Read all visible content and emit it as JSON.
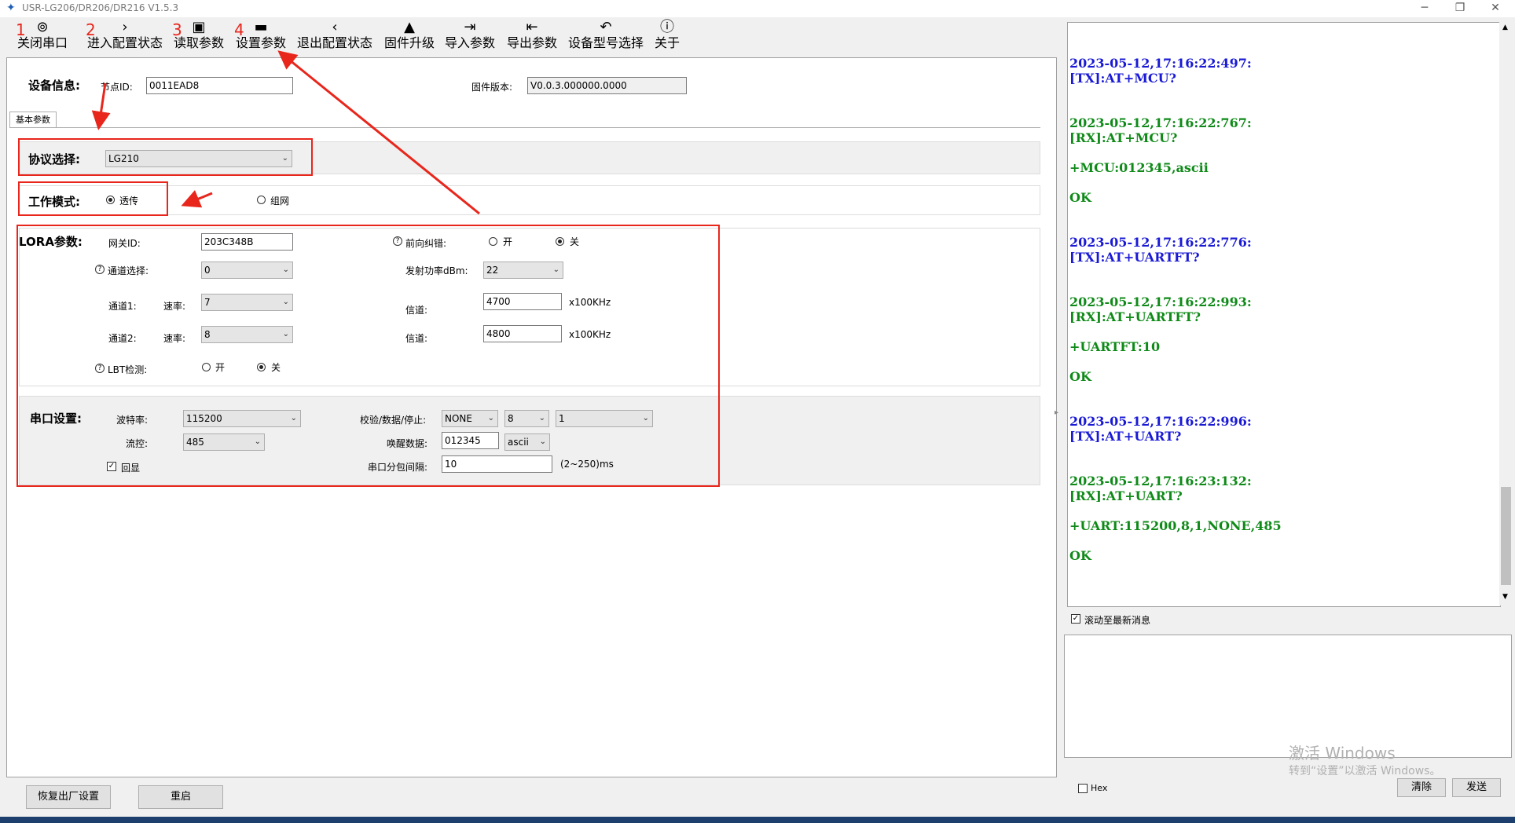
{
  "window": {
    "title": "USR-LG206/DR206/DR216 V1.5.3"
  },
  "toolbar": {
    "items": [
      {
        "num": "1",
        "label": "关闭串口",
        "icon": "location-pin-icon"
      },
      {
        "num": "2",
        "label": "进入配置状态",
        "icon": "chevron-right-icon"
      },
      {
        "num": "3",
        "label": "读取参数",
        "icon": "read-params-icon"
      },
      {
        "num": "4",
        "label": "设置参数",
        "icon": "save-icon"
      },
      {
        "num": "",
        "label": "退出配置状态",
        "icon": "chevron-left-icon"
      },
      {
        "num": "",
        "label": "固件升级",
        "icon": "rocket-icon"
      },
      {
        "num": "",
        "label": "导入参数",
        "icon": "import-icon"
      },
      {
        "num": "",
        "label": "导出参数",
        "icon": "export-icon"
      },
      {
        "num": "",
        "label": "设备型号选择",
        "icon": "undo-icon"
      },
      {
        "num": "",
        "label": "关于",
        "icon": "info-icon"
      }
    ]
  },
  "device": {
    "heading": "设备信息:",
    "node_id_label": "节点ID:",
    "node_id": "0011EAD8",
    "firmware_label": "固件版本:",
    "firmware": "V0.0.3.000000.0000",
    "tab": "基本参数"
  },
  "protocol": {
    "label": "协议选择:",
    "value": "LG210"
  },
  "workmode": {
    "label": "工作模式:",
    "opt1": "透传",
    "opt2": "组网",
    "selected": "透传"
  },
  "lora": {
    "heading": "LORA参数:",
    "gateway_label": "网关ID:",
    "gateway_id": "203C348B",
    "fec_label": "前向纠错:",
    "fec_on": "开",
    "fec_off": "关",
    "channel_sel_label": "通道选择:",
    "channel_sel": "0",
    "tx_power_label": "发射功率dBm:",
    "tx_power": "22",
    "ch1_label": "通道1:",
    "rate_label": "速率:",
    "ch1_rate": "7",
    "ch2_label": "通道2:",
    "ch2_rate": "8",
    "freq_label": "信道:",
    "ch1_freq": "4700",
    "ch2_freq": "4800",
    "freq_unit": "x100KHz",
    "lbt_label": "LBT检测:",
    "lbt_on": "开",
    "lbt_off": "关"
  },
  "serial": {
    "heading": "串口设置:",
    "baud_label": "波特率:",
    "baud": "115200",
    "parity_label": "校验/数据/停止:",
    "parity": "NONE",
    "databits": "8",
    "stopbits": "1",
    "flow_label": "流控:",
    "flow": "485",
    "wake_label": "唤醒数据:",
    "wake": "012345",
    "wake_fmt": "ascii",
    "echo_label": "回显",
    "interval_label": "串口分包间隔:",
    "interval": "10",
    "interval_unit": "(2~250)ms"
  },
  "bottom": {
    "factory": "恢复出厂设置",
    "restart": "重启"
  },
  "log": {
    "lines": [
      {
        "t": "2023-05-12,17:16:22:497:",
        "c": "tx"
      },
      {
        "t": "[TX]:AT+MCU?",
        "c": "tx"
      },
      {
        "t": "2023-05-12,17:16:22:767:",
        "c": "rx"
      },
      {
        "t": "[RX]:AT+MCU?",
        "c": "rx"
      },
      {
        "t": "+MCU:012345,ascii",
        "c": "rx"
      },
      {
        "t": "OK",
        "c": "rx"
      },
      {
        "t": "2023-05-12,17:16:22:776:",
        "c": "tx"
      },
      {
        "t": "[TX]:AT+UARTFT?",
        "c": "tx"
      },
      {
        "t": "2023-05-12,17:16:22:993:",
        "c": "rx"
      },
      {
        "t": "[RX]:AT+UARTFT?",
        "c": "rx"
      },
      {
        "t": "+UARTFT:10",
        "c": "rx"
      },
      {
        "t": "OK",
        "c": "rx"
      },
      {
        "t": "2023-05-12,17:16:22:996:",
        "c": "tx"
      },
      {
        "t": "[TX]:AT+UART?",
        "c": "tx"
      },
      {
        "t": "2023-05-12,17:16:23:132:",
        "c": "rx"
      },
      {
        "t": "[RX]:AT+UART?",
        "c": "rx"
      },
      {
        "t": "+UART:115200,8,1,NONE,485",
        "c": "rx"
      },
      {
        "t": "OK",
        "c": "rx"
      }
    ],
    "autoscroll_label": "滚动至最新消息",
    "hex_label": "Hex",
    "clear": "清除",
    "send": "发送"
  },
  "watermark": {
    "line1": "激活 Windows",
    "line2": "转到“设置”以激活 Windows。"
  },
  "colors": {
    "annotation": "#e8261c",
    "tx": "#1a1ad6",
    "rx": "#0f8a18"
  }
}
